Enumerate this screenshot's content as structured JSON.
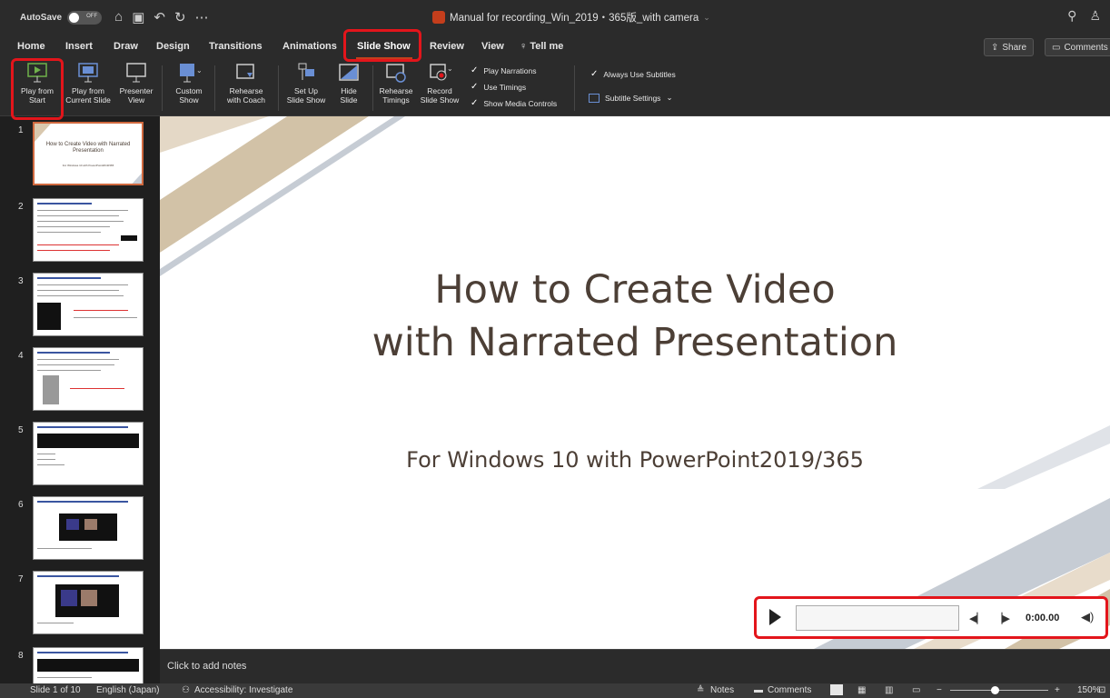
{
  "titlebar": {
    "autosave_label": "AutoSave",
    "autosave_state": "OFF",
    "doc_title": "Manual for recording_Win_2019・365版_with camera"
  },
  "tabs": [
    "Home",
    "Insert",
    "Draw",
    "Design",
    "Transitions",
    "Animations",
    "Slide Show",
    "Review",
    "View",
    "Tell me"
  ],
  "active_tab": "Slide Show",
  "share_label": "Share",
  "comments_label": "Comments",
  "ribbon": {
    "buttons": [
      {
        "label1": "Play from",
        "label2": "Start"
      },
      {
        "label1": "Play from",
        "label2": "Current Slide"
      },
      {
        "label1": "Presenter",
        "label2": "View"
      },
      {
        "label1": "Custom",
        "label2": "Show"
      },
      {
        "label1": "Rehearse",
        "label2": "with Coach"
      },
      {
        "label1": "Set Up",
        "label2": "Slide Show"
      },
      {
        "label1": "Hide",
        "label2": "Slide"
      },
      {
        "label1": "Rehearse",
        "label2": "Timings"
      },
      {
        "label1": "Record",
        "label2": "Slide Show"
      }
    ],
    "checks": [
      "Play Narrations",
      "Use Timings",
      "Show Media Controls"
    ],
    "always_subtitles": "Always Use Subtitles",
    "subtitle_settings": "Subtitle Settings"
  },
  "thumbnails": [
    "1",
    "2",
    "3",
    "4",
    "5",
    "6",
    "7",
    "8"
  ],
  "thumb1": {
    "title": "How to Create Video with Narrated Presentation",
    "subtitle": "For Windows 10 with PowerPoint2019/365"
  },
  "slide": {
    "title_line1": "How to Create Video",
    "title_line2": "with Narrated Presentation",
    "subtitle": "For Windows 10 with PowerPoint2019/365"
  },
  "media": {
    "time": "0:00.00"
  },
  "notes_placeholder": "Click to add notes",
  "status": {
    "slide_info": "Slide 1 of 10",
    "language": "English (Japan)",
    "accessibility": "Accessibility: Investigate",
    "notes": "Notes",
    "comments": "Comments",
    "zoom": "150%"
  }
}
